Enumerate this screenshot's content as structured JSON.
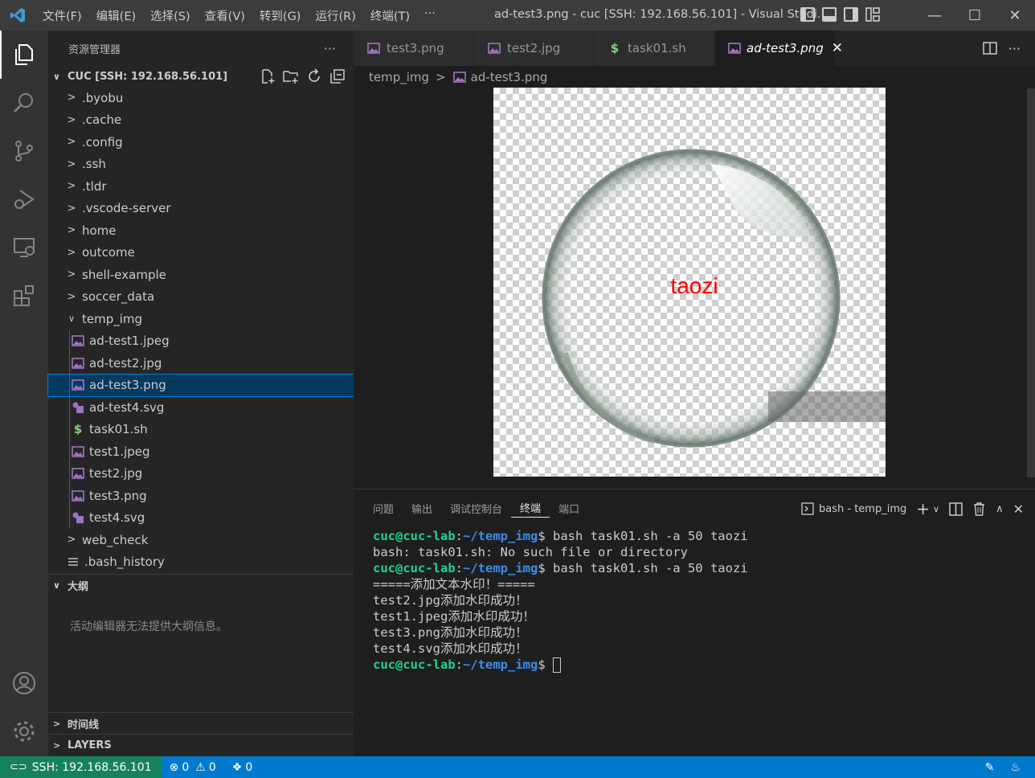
{
  "titlebar": {
    "menu": [
      "文件(F)",
      "编辑(E)",
      "选择(S)",
      "查看(V)",
      "转到(G)",
      "运行(R)",
      "终端(T)",
      "···"
    ],
    "window_title": "ad-test3.png - cuc [SSH: 192.168.56.101] - Visual Studi..."
  },
  "sidebar": {
    "title": "资源管理器",
    "more": "···",
    "root_label": "CUC [SSH: 192.168.56.101]",
    "tree": [
      {
        "label": ".byobu",
        "kind": "folder"
      },
      {
        "label": ".cache",
        "kind": "folder"
      },
      {
        "label": ".config",
        "kind": "folder"
      },
      {
        "label": ".ssh",
        "kind": "folder"
      },
      {
        "label": ".tldr",
        "kind": "folder"
      },
      {
        "label": ".vscode-server",
        "kind": "folder"
      },
      {
        "label": "home",
        "kind": "folder"
      },
      {
        "label": "outcome",
        "kind": "folder"
      },
      {
        "label": "shell-example",
        "kind": "folder"
      },
      {
        "label": "soccer_data",
        "kind": "folder"
      },
      {
        "label": "temp_img",
        "kind": "folder-open"
      },
      {
        "label": "ad-test1.jpeg",
        "kind": "image",
        "child": true
      },
      {
        "label": "ad-test2.jpg",
        "kind": "image",
        "child": true
      },
      {
        "label": "ad-test3.png",
        "kind": "image",
        "child": true,
        "selected": true
      },
      {
        "label": "ad-test4.svg",
        "kind": "svg",
        "child": true
      },
      {
        "label": "task01.sh",
        "kind": "shell",
        "child": true
      },
      {
        "label": "test1.jpeg",
        "kind": "image",
        "child": true
      },
      {
        "label": "test2.jpg",
        "kind": "image",
        "child": true
      },
      {
        "label": "test3.png",
        "kind": "image",
        "child": true
      },
      {
        "label": "test4.svg",
        "kind": "svg",
        "child": true
      },
      {
        "label": "web_check",
        "kind": "folder"
      },
      {
        "label": ".bash_history",
        "kind": "file"
      }
    ],
    "outline_title": "大纲",
    "outline_message": "活动编辑器无法提供大纲信息。",
    "timeline_title": "时间线",
    "layers_title": "LAYERS"
  },
  "editor": {
    "tabs": [
      {
        "label": "test3.png",
        "kind": "image"
      },
      {
        "label": "test2.jpg",
        "kind": "image"
      },
      {
        "label": "task01.sh",
        "kind": "shell"
      },
      {
        "label": "ad-test3.png",
        "kind": "image",
        "active": true
      }
    ],
    "breadcrumb": [
      "temp_img",
      "ad-test3.png"
    ],
    "image_text": "taozi"
  },
  "panel": {
    "tabs": [
      "问题",
      "输出",
      "调试控制台",
      "终端",
      "端口"
    ],
    "active_tab": "终端",
    "terminal_select": "bash - temp_img",
    "lines": [
      {
        "user": "cuc@cuc-lab",
        "path": "~/temp_img",
        "cmd": " bash task01.sh -a 50 taozi"
      },
      {
        "text": "bash: task01.sh: No such file or directory"
      },
      {
        "user": "cuc@cuc-lab",
        "path": "~/temp_img",
        "cmd": " bash task01.sh -a 50 taozi"
      },
      {
        "text": "=====添加文本水印！====="
      },
      {
        "text": "test2.jpg添加水印成功！"
      },
      {
        "text": "test1.jpeg添加水印成功！"
      },
      {
        "text": "test3.png添加水印成功！"
      },
      {
        "text": "test4.svg添加水印成功！"
      },
      {
        "user": "cuc@cuc-lab",
        "path": "~/temp_img",
        "cmd": " ",
        "cursor": true
      }
    ]
  },
  "statusbar": {
    "remote": "SSH: 192.168.56.101",
    "errors": "0",
    "warnings": "0",
    "ports": "0"
  },
  "colors": {
    "accent": "#007acc",
    "remote": "#16825d",
    "prompt_user": "#23d18b",
    "prompt_path": "#3b8eea",
    "watermark_text": "#ff0000"
  }
}
